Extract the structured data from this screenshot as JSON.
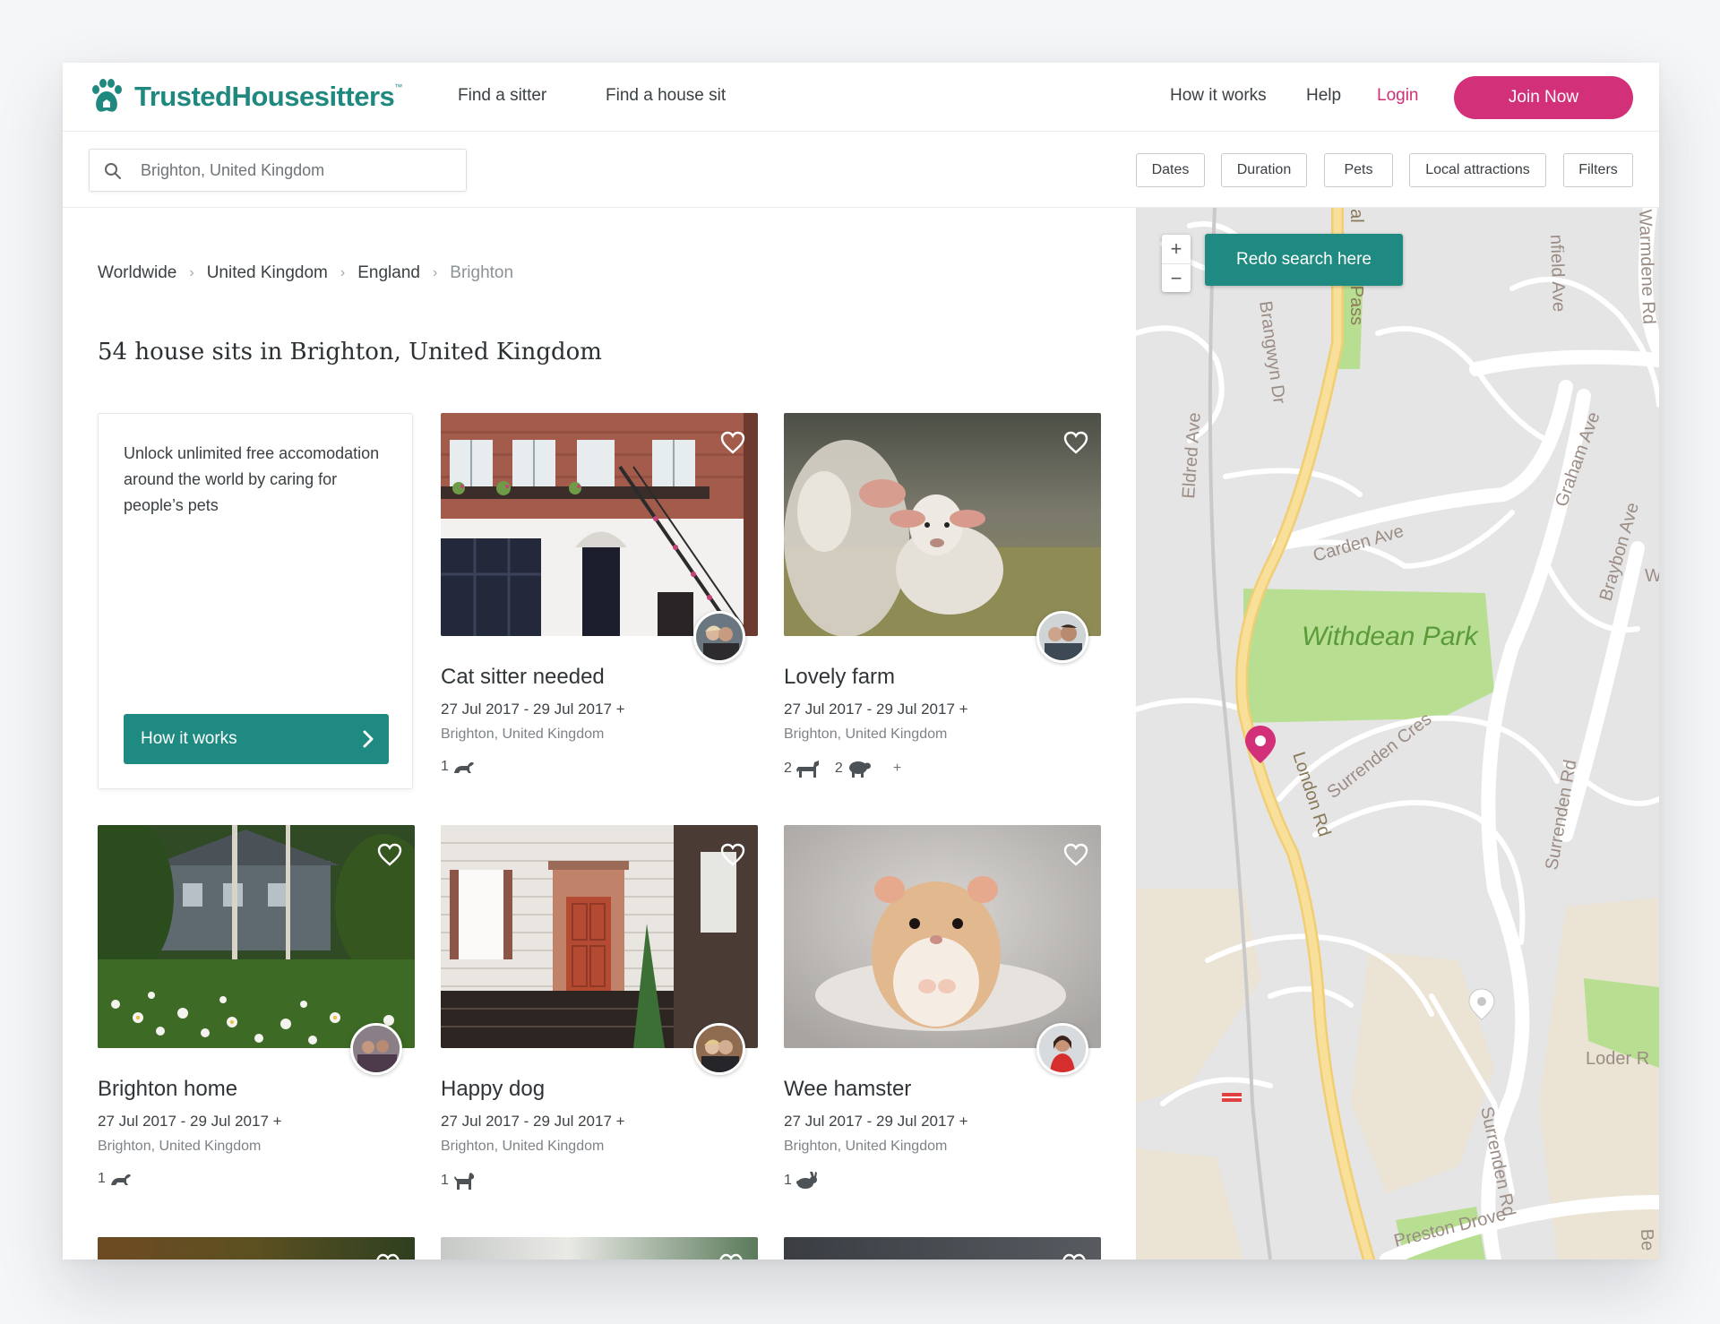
{
  "header": {
    "logo_text": "TrustedHousesitters",
    "logo_tm": "™",
    "nav": [
      "Find a sitter",
      "Find a house sit"
    ],
    "how_it_works": "How it works",
    "help": "Help",
    "login": "Login",
    "join": "Join Now"
  },
  "search": {
    "value": "Brighton, United Kingdom"
  },
  "filters": [
    "Dates",
    "Duration",
    "Pets",
    "Local attractions",
    "Filters"
  ],
  "breadcrumb": [
    "Worldwide",
    "United Kingdom",
    "England",
    "Brighton"
  ],
  "results_title": "54 house sits in Brighton, United Kingdom",
  "promo": {
    "text": "Unlock unlimited free accomodation around the world by caring for people’s pets",
    "button": "How it works"
  },
  "listings": [
    {
      "title": "Cat sitter needed",
      "dates": "27 Jul 2017 - 29 Jul 2017 +",
      "location": "Brighton, United Kingdom",
      "pets": [
        {
          "count": "1",
          "icon": "reptile-icon"
        }
      ],
      "more": ""
    },
    {
      "title": "Lovely farm",
      "dates": "27 Jul 2017 - 29 Jul 2017 +",
      "location": "Brighton, United Kingdom",
      "pets": [
        {
          "count": "2",
          "icon": "horse-icon"
        },
        {
          "count": "2",
          "icon": "sheep-icon"
        }
      ],
      "more": "+"
    },
    {
      "title": "Brighton home",
      "dates": "27 Jul 2017 - 29 Jul 2017 +",
      "location": "Brighton, United Kingdom",
      "pets": [
        {
          "count": "1",
          "icon": "reptile-icon"
        }
      ],
      "more": ""
    },
    {
      "title": "Happy dog",
      "dates": "27 Jul 2017 - 29 Jul 2017 +",
      "location": "Brighton, United Kingdom",
      "pets": [
        {
          "count": "1",
          "icon": "dog-icon"
        }
      ],
      "more": ""
    },
    {
      "title": "Wee hamster",
      "dates": "27 Jul 2017 - 29 Jul 2017 +",
      "location": "Brighton, United Kingdom",
      "pets": [
        {
          "count": "1",
          "icon": "rabbit-icon"
        }
      ],
      "more": ""
    }
  ],
  "map": {
    "redo_button": "Redo search here",
    "zoom_in": "+",
    "zoom_out": "−",
    "labels": [
      "Withdean Park",
      "London Rd",
      "Carden Ave",
      "Surrenden Cres",
      "Surrenden Rd",
      "Preston Drove",
      "Eldred Ave",
      "Brangwyn Dr",
      "Graham Ave",
      "Braybon Ave",
      "Loder R",
      "nfield Ave",
      "Warmdene Rd",
      "-Pass",
      "nal",
      "W",
      "Be"
    ]
  },
  "colors": {
    "brand_teal": "#1f8a81",
    "brand_pink": "#d2317a"
  }
}
